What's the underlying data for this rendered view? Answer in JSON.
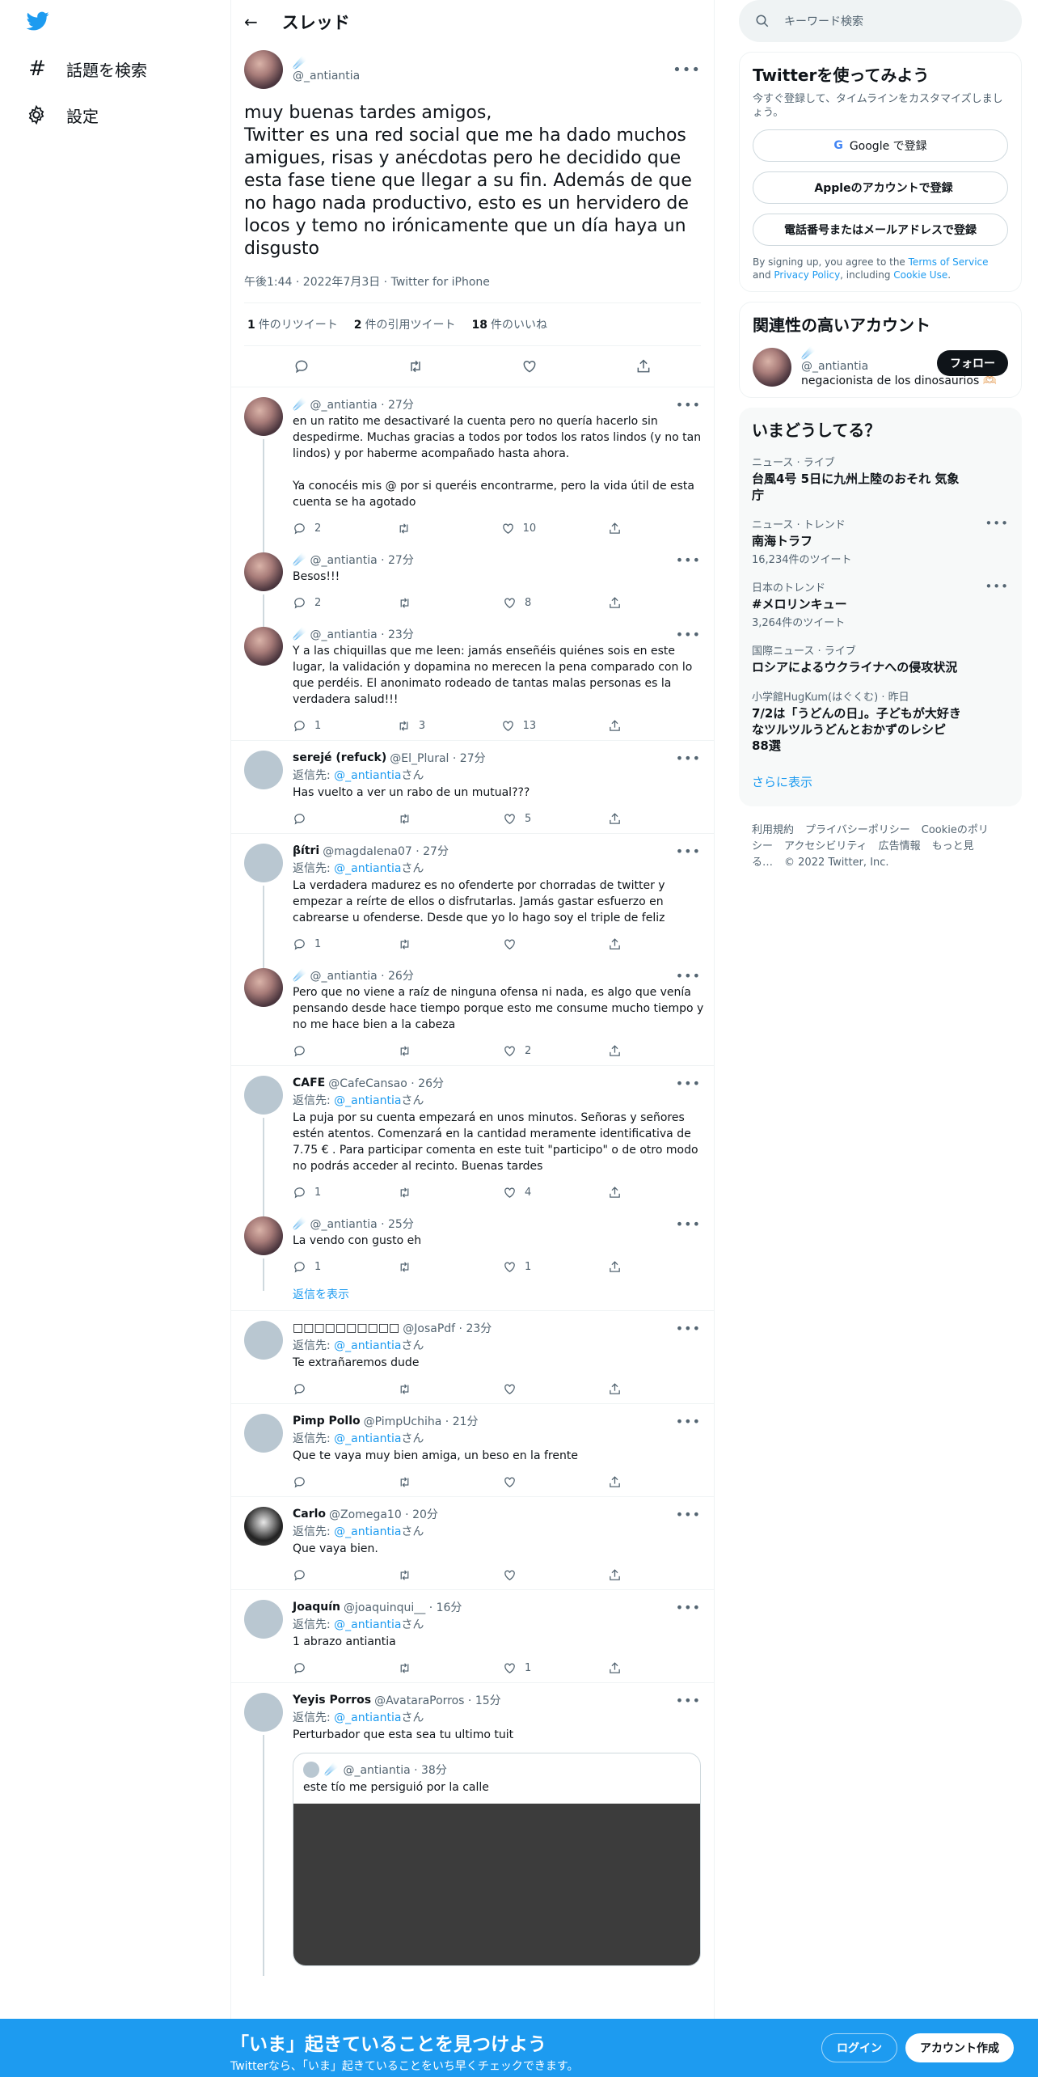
{
  "nav": {
    "explore": "話題を検索",
    "settings": "設定"
  },
  "header": {
    "title": "スレッド"
  },
  "main_tweet": {
    "name": "☄️",
    "handle": "@_antiantia",
    "text": "muy buenas tardes amigos,\nTwitter es una red social que me ha dado muchos amigues, risas y anécdotas pero he decidido que esta fase tiene que llegar a su fin. Además de que no hago nada productivo, esto es un hervidero de locos y temo no irónicamente que un día haya un disgusto",
    "meta": "午後1:44 · 2022年7月3日 · Twitter for iPhone",
    "retweets": "1",
    "retweets_label": "件のリツイート",
    "quotes": "2",
    "quotes_label": "件の引用ツイート",
    "likes": "18",
    "likes_label": "件のいいね"
  },
  "replying_prefix": "返信先: ",
  "replying_suffix": "さん",
  "replies": [
    {
      "name": "☄️",
      "handle": "@_antiantia · 27分",
      "replying": "",
      "text": "en un ratito me desactivaré la cuenta pero no quería hacerlo sin despedirme. Muchas gracias a todos por todos los ratos lindos (y no tan lindos) y por haberme acompañado hasta ahora.\n\nYa conocéis mis @ por si queréis encontrarme, pero la vida útil de esta cuenta se ha agotado",
      "reply": "2",
      "rt": "",
      "like": "10"
    },
    {
      "name": "☄️",
      "handle": "@_antiantia · 27分",
      "replying": "",
      "text": "Besos!!!",
      "reply": "2",
      "rt": "",
      "like": "8"
    },
    {
      "name": "☄️",
      "handle": "@_antiantia · 23分",
      "replying": "",
      "text": "Y a las chiquillas que me leen: jamás enseñéis quiénes sois en este lugar, la validación y dopamina no merecen la pena comparado con lo que perdéis. El anonimato rodeado de tantas malas personas es la verdadera salud!!!",
      "reply": "1",
      "rt": "3",
      "like": "13"
    },
    {
      "name": "serejé (refuck)",
      "handle": "@El_Plural · 27分",
      "replying": "@_antiantia",
      "text": "Has vuelto a ver un rabo de un mutual???",
      "reply": "",
      "rt": "",
      "like": "5"
    },
    {
      "name": "βítri",
      "handle": "@magdaIena07 · 27分",
      "replying": "@_antiantia",
      "text": "La verdadera madurez es no ofenderte por chorradas de twitter y empezar a reírte de ellos o disfrutarlas. Jamás gastar esfuerzo en cabrearse u ofenderse. Desde que yo lo hago soy el triple de feliz",
      "reply": "1",
      "rt": "",
      "like": ""
    },
    {
      "name": "☄️",
      "handle": "@_antiantia · 26分",
      "replying": "",
      "text": "Pero que no viene a raíz de ninguna ofensa ni nada, es algo que venía pensando desde hace tiempo porque esto me consume mucho tiempo y no me hace bien a la cabeza",
      "reply": "",
      "rt": "",
      "like": "2"
    },
    {
      "name": "CAFE",
      "handle": "@CafeCansao · 26分",
      "replying": "@_antiantia",
      "text": "La puja por su cuenta empezará en unos minutos. Señoras y señores estén atentos. Comenzará en la cantidad meramente identificativa de 7.75 € . Para participar comenta en este tuit \"participo\" o de otro modo no podrás acceder al recinto. Buenas tardes",
      "reply": "1",
      "rt": "",
      "like": "4"
    },
    {
      "name": "☄️",
      "handle": "@_antiantia · 25分",
      "replying": "",
      "text": "La vendo con gusto eh",
      "reply": "1",
      "rt": "",
      "like": "1"
    }
  ],
  "show_replies": "返信を表示",
  "replies2": [
    {
      "name": "□□□□□□□□□□",
      "handle": "@JosaPdf · 23分",
      "replying": "@_antiantia",
      "text": "Te extrañaremos dude",
      "reply": "",
      "rt": "",
      "like": ""
    },
    {
      "name": "Pimp Pollo",
      "handle": "@PimpUchiha · 21分",
      "replying": "@_antiantia",
      "text": "Que te vaya muy bien amiga, un beso en la frente",
      "reply": "",
      "rt": "",
      "like": ""
    },
    {
      "name": "Carlo",
      "handle": "@Zomega10 · 20分",
      "replying": "@_antiantia",
      "text": "Que vaya bien.",
      "reply": "",
      "rt": "",
      "like": ""
    },
    {
      "name": "Joaquín",
      "handle": "@joaquinqui__ · 16分",
      "replying": "@_antiantia",
      "text": "1 abrazo antiantia",
      "reply": "",
      "rt": "",
      "like": "1"
    },
    {
      "name": "Yeyis Porros",
      "handle": "@AvataraPorros · 15分",
      "replying": "@_antiantia",
      "text": "Perturbador que esta sea tu ultimo tuit",
      "reply": "",
      "rt": "",
      "like": ""
    }
  ],
  "quote": {
    "name": "☄️",
    "handle": "@_antiantia · 38分",
    "text": "este tío me persiguió por la calle"
  },
  "search": {
    "placeholder": "キーワード検索"
  },
  "signup": {
    "title": "Twitterを使ってみよう",
    "sub": "今すぐ登録して、タイムラインをカスタマイズしましょう。",
    "google": "Google で登録",
    "apple": "Appleのアカウントで登録",
    "phone": "電話番号またはメールアドレスで登録",
    "terms1": "By signing up, you agree to the ",
    "terms_tos": "Terms of Service",
    "terms2": " and ",
    "terms_pp": "Privacy Policy",
    "terms3": ", including ",
    "terms_cookie": "Cookie Use",
    "terms4": "."
  },
  "related": {
    "title": "関連性の高いアカウント",
    "name": "☄️",
    "handle": "@_antiantia",
    "bio": "negacionista de los dinosaurios 🫶🏻",
    "follow": "フォロー"
  },
  "trends": {
    "title": "いまどうしてる？",
    "items": [
      {
        "cat": "ニュース · ライブ",
        "t": "台風4号 5日に九州上陸のおそれ 気象庁",
        "cnt": ""
      },
      {
        "cat": "ニュース · トレンド",
        "t": "南海トラフ",
        "cnt": "16,234件のツイート"
      },
      {
        "cat": "日本のトレンド",
        "t": "#メロリンキュー",
        "cnt": "3,264件のツイート"
      },
      {
        "cat": "国際ニュース · ライブ",
        "t": "ロシアによるウクライナへの侵攻状況",
        "cnt": ""
      },
      {
        "cat": "小学館HugKum(はぐくむ) · 昨日",
        "t": "7/2は「うどんの日」。子どもが大好きなツルツルうどんとおかずのレシピ88選",
        "cnt": ""
      }
    ],
    "show_more": "さらに表示"
  },
  "footer": [
    "利用規約",
    "プライバシーポリシー",
    "Cookieのポリシー",
    "アクセシビリティ",
    "広告情報",
    "もっと見る…",
    "© 2022 Twitter, Inc."
  ],
  "bottom": {
    "title": "「いま」起きていることを見つけよう",
    "sub": "Twitterなら、「いま」起きていることをいち早くチェックできます。",
    "login": "ログイン",
    "signup": "アカウント作成"
  },
  "colors": {
    "accent": "#1d9bf0",
    "text": "#0f1419",
    "muted": "#536471"
  }
}
